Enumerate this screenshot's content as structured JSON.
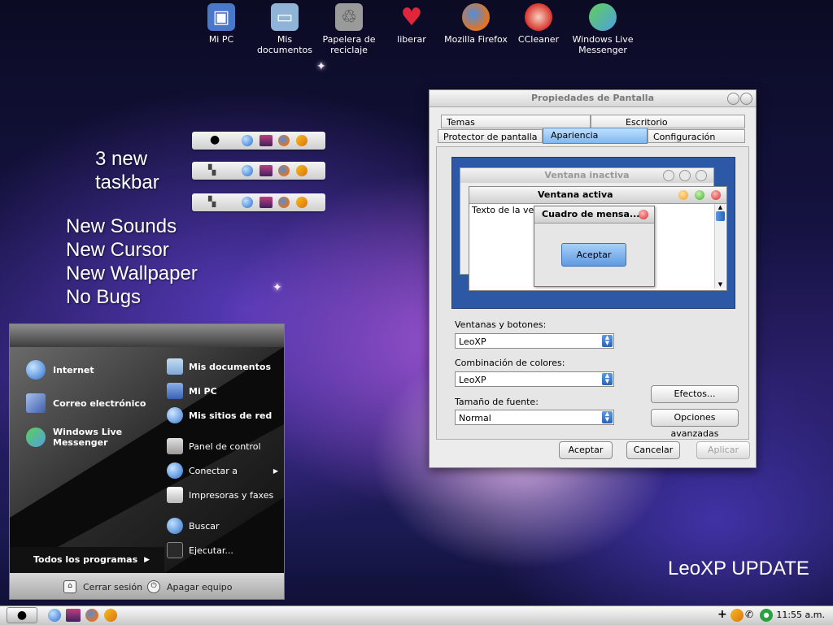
{
  "desktop": {
    "icons": [
      {
        "label": "Mi PC",
        "icon": "computer-icon",
        "color": "#4a78c8"
      },
      {
        "label": "Mis documentos",
        "icon": "folder-icon",
        "color": "#8fb4d8"
      },
      {
        "label": "Papelera de reciclaje",
        "icon": "trash-icon",
        "color": "#9a9a9a"
      },
      {
        "label": "liberar",
        "icon": "heart-icon",
        "color": "#e0263a"
      },
      {
        "label": "Mozilla Firefox",
        "icon": "firefox-icon",
        "color": "#e8731a"
      },
      {
        "label": "CCleaner",
        "icon": "ccleaner-icon",
        "color": "#d8322a"
      },
      {
        "label": "Windows Live Messenger",
        "icon": "messenger-icon",
        "color": "#4fa0e0"
      }
    ],
    "promo": {
      "taskbar_line1": "3 new",
      "taskbar_line2": "taskbar",
      "features": [
        "New Sounds",
        "New Cursor",
        "New Wallpaper",
        "No Bugs"
      ]
    },
    "brand": "LeoXP UPDATE"
  },
  "window": {
    "title": "Propiedades de Pantalla",
    "tabs_back": [
      "Temas",
      "Escritorio"
    ],
    "tabs_front": [
      "Protector de pantalla",
      "Apariencia",
      "Configuración"
    ],
    "active_tab": "Apariencia",
    "preview": {
      "inactive_title": "Ventana inactiva",
      "active_title": "Ventana activa",
      "window_text": "Texto de la vent",
      "msgbox_title": "Cuadro de mensa...",
      "msgbox_button": "Aceptar"
    },
    "fields": [
      {
        "label": "Ventanas y botones:",
        "value": "LeoXP"
      },
      {
        "label": "Combinación de colores:",
        "value": "LeoXP"
      },
      {
        "label": "Tamaño de fuente:",
        "value": "Normal"
      }
    ],
    "effects_button": "Efectos...",
    "advanced_button": "Opciones avanzadas",
    "ok_button": "Aceptar",
    "cancel_button": "Cancelar",
    "apply_button": "Aplicar"
  },
  "start_menu": {
    "left_items": [
      {
        "label": "Internet",
        "icon": "globe-icon",
        "color": "#3a7fd8"
      },
      {
        "label": "Correo electrónico",
        "icon": "mail-icon",
        "color": "#6d8bc8"
      },
      {
        "label": "Windows Live Messenger",
        "icon": "messenger-icon",
        "color": "#4fa0e0"
      }
    ],
    "right_items_bold": [
      {
        "label": "Mis documentos",
        "icon": "folder-icon",
        "color": "#8fb4d8"
      },
      {
        "label": "Mi PC",
        "icon": "computer-icon",
        "color": "#4a78c8"
      },
      {
        "label": "Mis sitios de red",
        "icon": "network-icon",
        "color": "#6aa0e0"
      }
    ],
    "right_items": [
      {
        "label": "Panel de control",
        "icon": "control-panel-icon",
        "color": "#b0b0b0"
      },
      {
        "label": "Conectar a",
        "icon": "connect-icon",
        "color": "#3d78d0"
      },
      {
        "label": "Impresoras y faxes",
        "icon": "printer-icon",
        "color": "#d8d8d8"
      },
      {
        "label": "Buscar",
        "icon": "search-icon",
        "color": "#2f6fc8"
      },
      {
        "label": "Ejecutar...",
        "icon": "run-icon",
        "color": "#2a2a2a"
      }
    ],
    "all_programs": "Todos los programas",
    "logoff": "Cerrar sesión",
    "shutdown": "Apagar equipo"
  },
  "taskbar": {
    "clock": "11:55 a.m."
  }
}
